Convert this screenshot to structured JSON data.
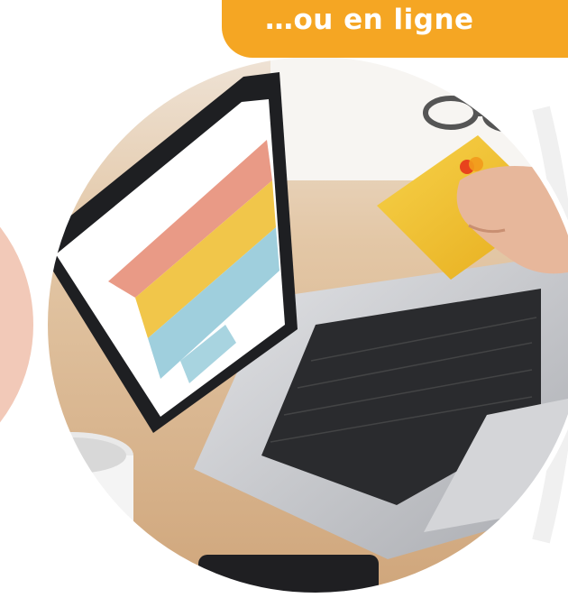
{
  "banner": {
    "text": "…ou en ligne"
  },
  "colors": {
    "banner_bg": "#f5a623",
    "banner_text": "#ffffff",
    "table": "#d9b48f",
    "laptop_shell": "#c9cbcf",
    "screen_bezel": "#1e1f22",
    "card": "#f2c232",
    "tile_pink": "#e99a86",
    "tile_yellow": "#f1c64a",
    "tile_blue": "#9fcfdd"
  },
  "icons": [
    "credit-card-icon"
  ],
  "scene_description_items": [
    "laptop",
    "credit-card",
    "hand",
    "coffee-mug",
    "glasses",
    "phone"
  ]
}
